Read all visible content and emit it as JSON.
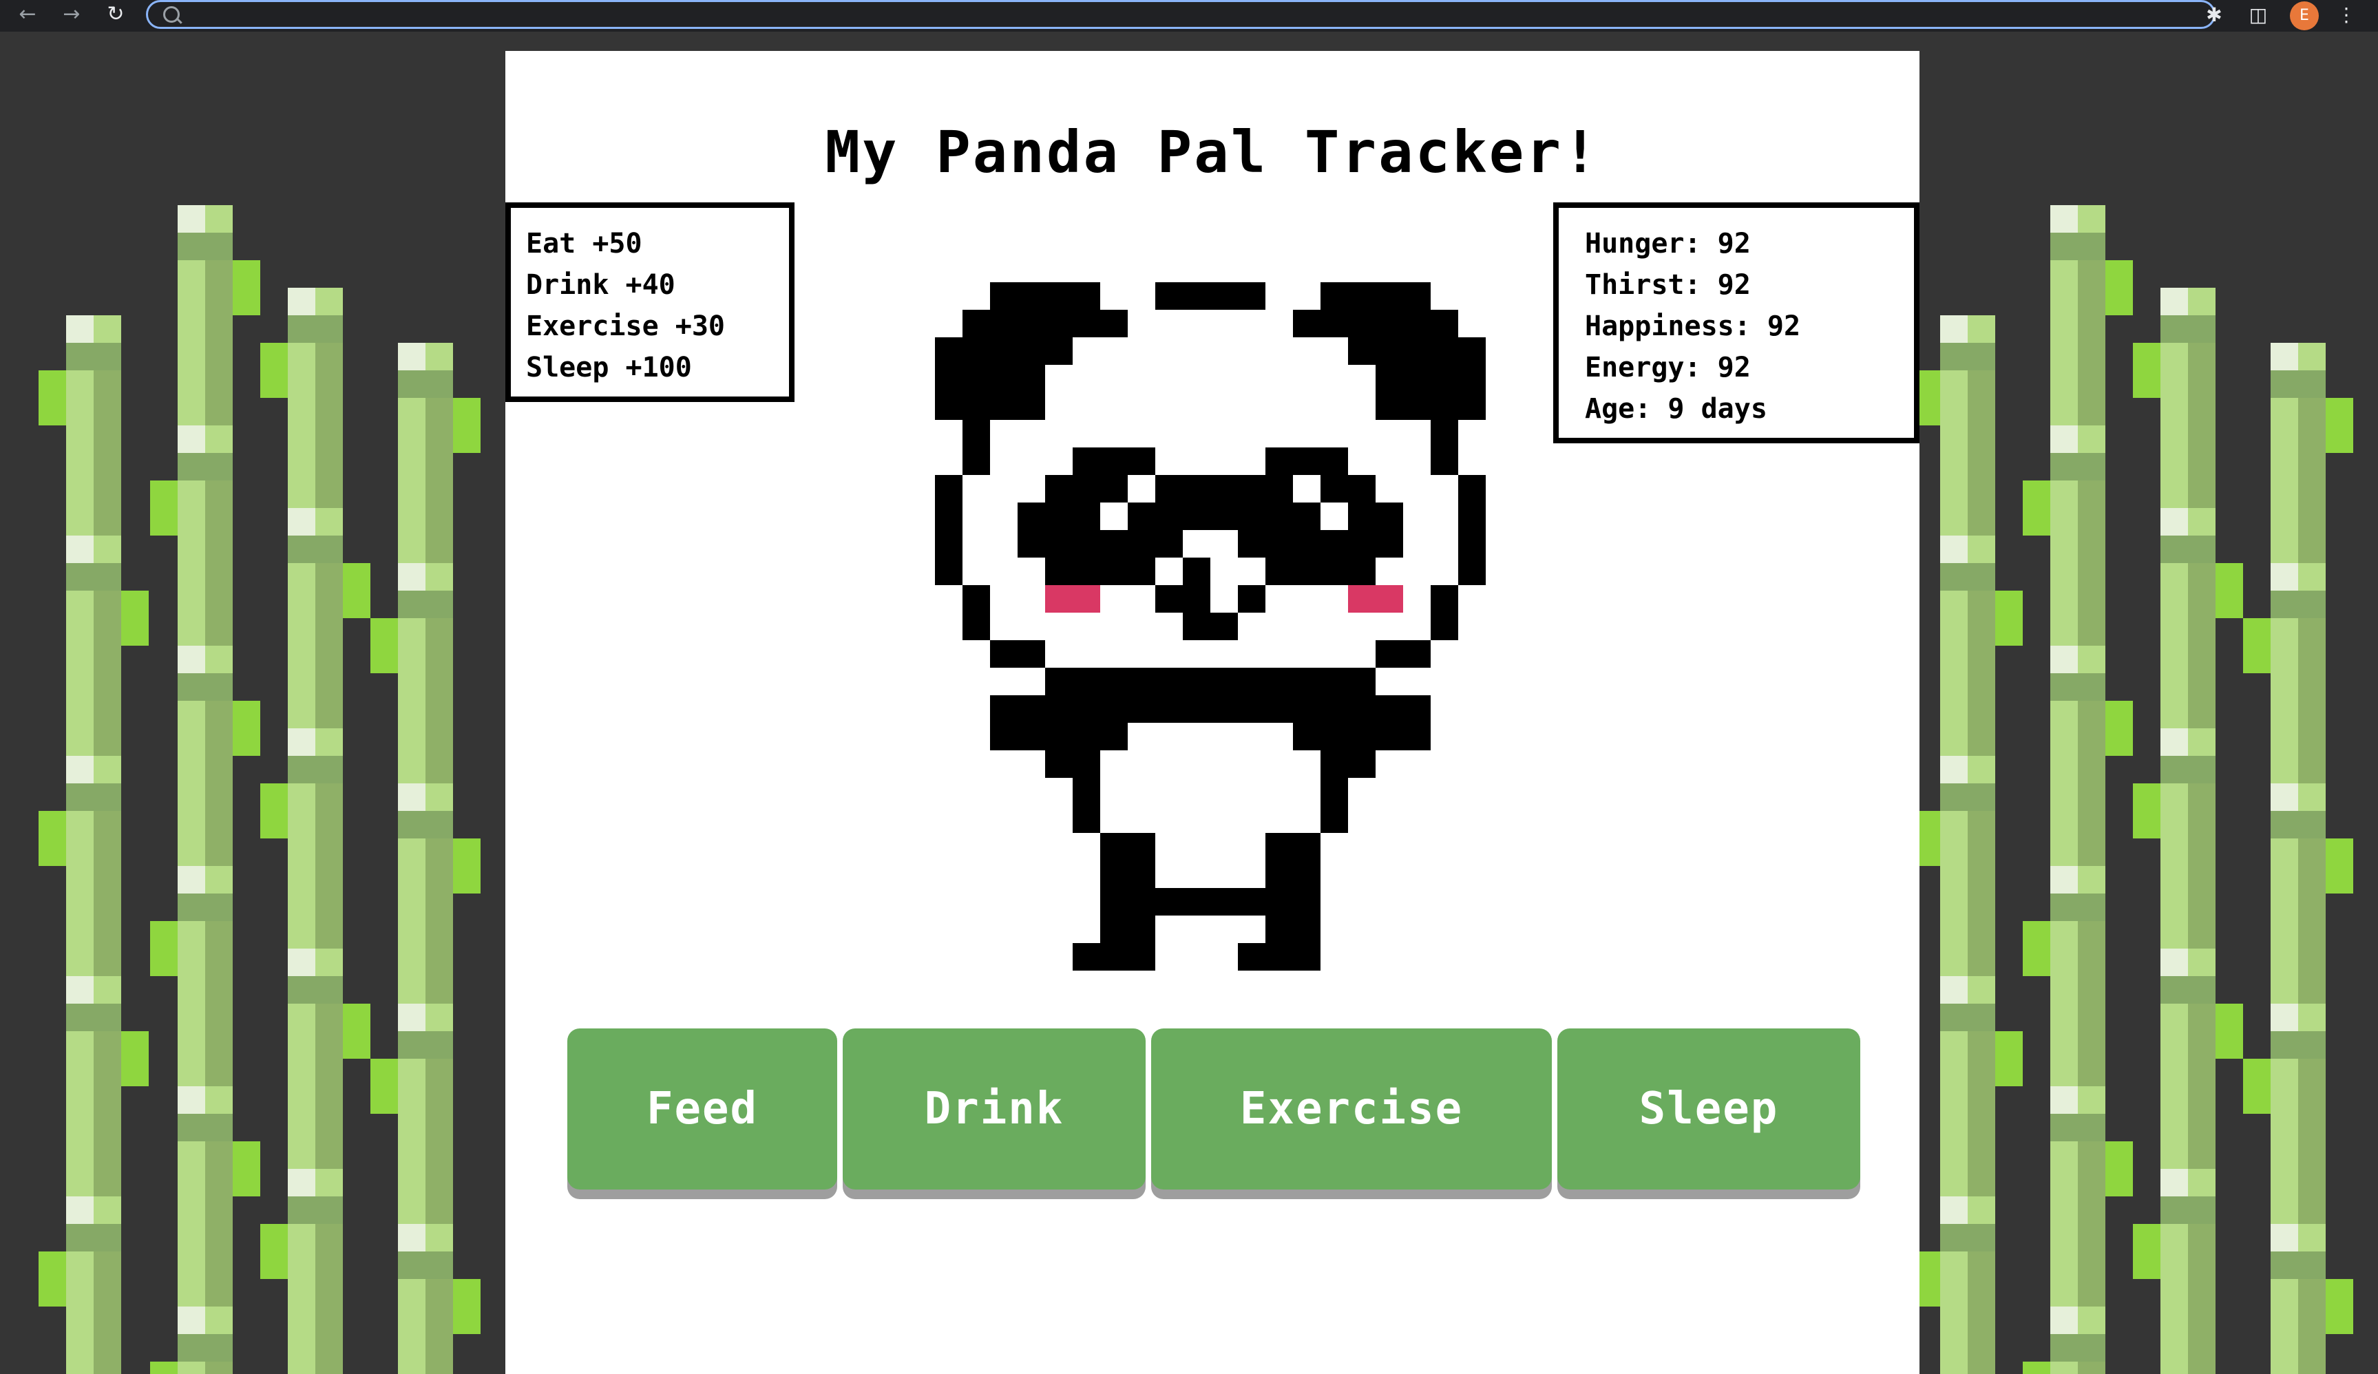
{
  "browser": {
    "back_icon": "arrow-left-icon",
    "forward_icon": "arrow-right-icon",
    "reload_icon": "reload-icon",
    "address_value": "",
    "profile_initial": "E"
  },
  "page": {
    "title": "My Panda Pal Tracker!",
    "legend": [
      {
        "text": "Eat +50"
      },
      {
        "text": "Drink +40"
      },
      {
        "text": "Exercise +30"
      },
      {
        "text": "Sleep +100"
      }
    ],
    "stats": [
      {
        "text": "Hunger: 92"
      },
      {
        "text": "Thirst: 92"
      },
      {
        "text": "Happiness: 92"
      },
      {
        "text": "Energy: 92"
      },
      {
        "text": "Age: 9 days"
      }
    ],
    "buttons": {
      "feed": "Feed",
      "drink": "Drink",
      "exercise": "Exercise",
      "sleep": "Sleep"
    }
  },
  "colors": {
    "background": "#353535",
    "card": "#ffffff",
    "button": "#6aac5e",
    "button_shadow": "#9e9e9e",
    "blush": "#d93864",
    "bamboo_light": "#b5db86",
    "bamboo_dark": "#86a966",
    "bamboo_leaf": "#8fd63f"
  }
}
